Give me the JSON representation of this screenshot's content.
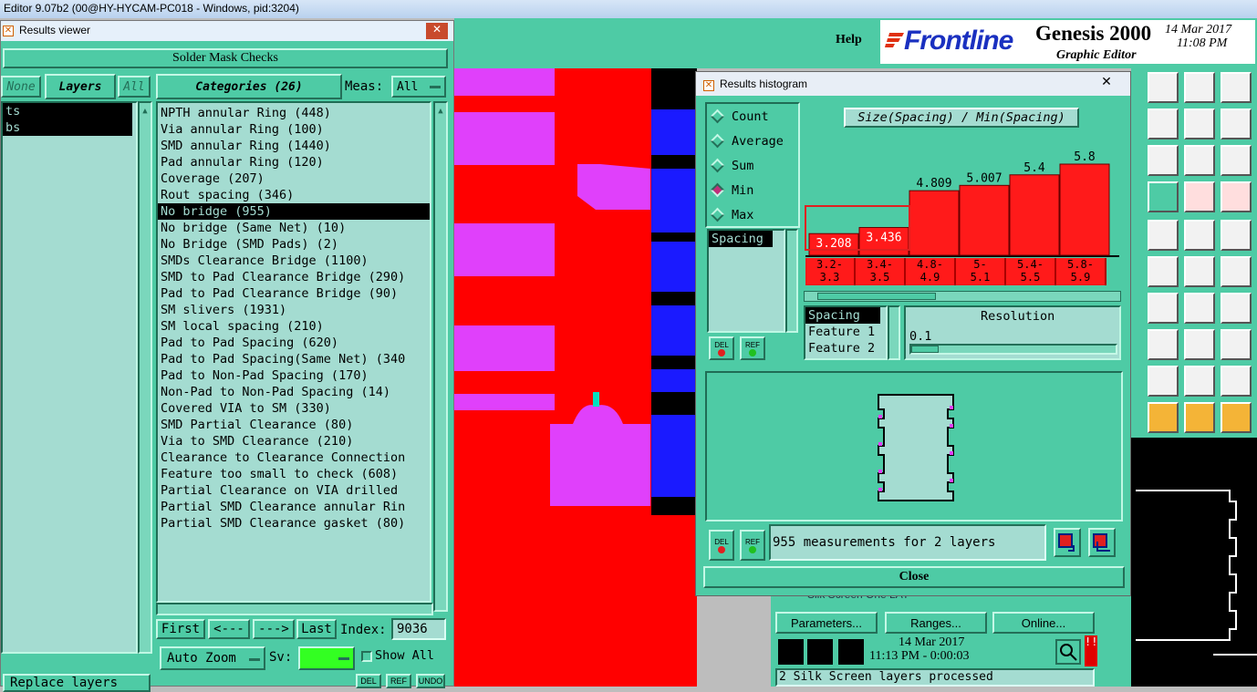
{
  "window_title": "Editor 9.07b2 (00@HY-HYCAM-PC018 - Windows, pid:3204)",
  "editor": {
    "help_label": "Help",
    "brand": "Frontline",
    "product": "Genesis 2000",
    "subtitle": "Graphic Editor",
    "date": "14 Mar 2017",
    "time": "11:08 PM"
  },
  "results_viewer": {
    "title": "Results viewer",
    "section_title": "Solder Mask Checks",
    "none_label": "None",
    "layers_label": "Layers",
    "all_label": "All",
    "layers": [
      "ts",
      "bs"
    ],
    "categories_label": "Categories (26)",
    "meas_label": "Meas:",
    "meas_value": "All",
    "categories": [
      "NPTH annular Ring (448)",
      "Via annular Ring (100)",
      "SMD annular Ring (1440)",
      "Pad annular Ring (120)",
      "Coverage (207)",
      "Rout spacing (346)",
      "No bridge (955)",
      "No bridge (Same Net) (10)",
      "No Bridge (SMD Pads) (2)",
      "SMDs Clearance Bridge (1100)",
      "SMD to Pad Clearance Bridge (290)",
      "Pad to Pad Clearance Bridge (90)",
      "SM slivers (1931)",
      "SM local spacing (210)",
      "Pad to Pad Spacing (620)",
      "Pad to Pad Spacing(Same Net) (340",
      "Pad to Non-Pad Spacing (170)",
      "Non-Pad to Non-Pad Spacing (14)",
      "Covered VIA to SM (330)",
      "SMD Partial Clearance (80)",
      "Via to SMD Clearance (210)",
      "Clearance to Clearance Connection",
      "Feature too small to check (608)",
      "Partial Clearance on VIA drilled",
      "Partial SMD Clearance annular Rin",
      "Partial SMD Clearance gasket (80)"
    ],
    "selected_category_index": 6,
    "nav": {
      "first": "First",
      "prev": "<---",
      "next": "--->",
      "last": "Last",
      "index_label": "Index:",
      "index_value": "9036"
    },
    "auto_zoom": "Auto Zoom",
    "sv_label": "Sv:",
    "show_all": "Show All",
    "replace_layers": "Replace layers",
    "del": "DEL",
    "ref": "REF",
    "undo": "UNDO"
  },
  "histogram": {
    "title": "Results histogram",
    "modes": [
      "Count",
      "Average",
      "Sum",
      "Min",
      "Max"
    ],
    "selected_mode": "Min",
    "chart_title": "Size(Spacing) / Min(Spacing)",
    "attributes": [
      "Spacing"
    ],
    "selected_attribute": "Spacing",
    "features": [
      "Spacing",
      "Feature 1",
      "Feature 2"
    ],
    "resolution_label": "Resolution",
    "resolution_value": "0.1",
    "status": "955 measurements for 2 layers",
    "close_label": "Close",
    "del": "DEL",
    "ref": "REF"
  },
  "chart_data": {
    "type": "bar",
    "title": "Size(Spacing) / Min(Spacing)",
    "categories": [
      "3.2-3.3",
      "3.4-3.5",
      "4.8-4.9",
      "5-5.1",
      "5.4-5.5",
      "5.8-5.9"
    ],
    "category_lines": [
      [
        "3.2-",
        "3.3"
      ],
      [
        "3.4-",
        "3.5"
      ],
      [
        "4.8-",
        "4.9"
      ],
      [
        "5-",
        "5.1"
      ],
      [
        "5.4-",
        "5.5"
      ],
      [
        "5.8-",
        "5.9"
      ]
    ],
    "values": [
      3.208,
      3.436,
      4.809,
      5.007,
      5.4,
      5.8
    ],
    "value_labels": [
      "3.208",
      "3.436",
      "4.809",
      "5.007",
      "5.4",
      "5.8"
    ],
    "highlighted": [
      0,
      1
    ],
    "ylim": [
      2.4,
      5.8
    ],
    "colors": {
      "bar": "#ff1a1a",
      "highlight_label": "#ff1a1a",
      "label": "#000000"
    }
  },
  "right_panel": {
    "parameters": "Parameters...",
    "ranges": "Ranges...",
    "online": "Online...",
    "behind_text": "Silk Screen One LAY",
    "date": "14 Mar 2017",
    "time": "11:13 PM - 0:00:03",
    "status": "2 Silk Screen layers processed"
  },
  "colors": {
    "panel": "#4ecba5",
    "field": "#a4dcd1",
    "copper": "#ff0000",
    "mask": "#e040fb",
    "blue": "#1a1aff"
  }
}
